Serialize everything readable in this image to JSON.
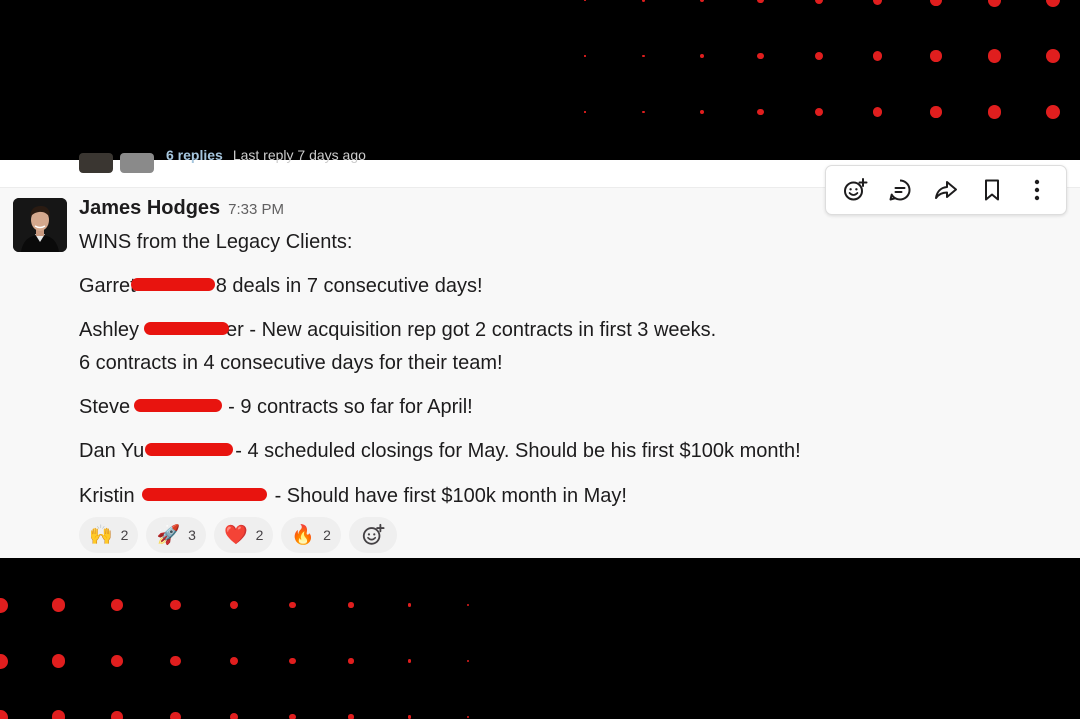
{
  "previous_thread": {
    "replies": "6 replies",
    "last_reply": "Last reply 7 days ago"
  },
  "message": {
    "author": "James Hodges",
    "time": "7:33 PM",
    "intro": "WINS from the Legacy Clients:",
    "wins": [
      {
        "name": "Garret",
        "text": "8 deals in 7 consecutive days!"
      },
      {
        "name": "Ashley",
        "text": "er - New acquisition rep got 2 contracts in first 3 weeks."
      },
      {
        "continuation": "6 contracts in 4 consecutive days for their team!"
      },
      {
        "name": "Steve",
        "text": "- 9 contracts so far for April!"
      },
      {
        "name": "Dan Yu",
        "text": "- 4 scheduled closings for May. Should be his first $100k month!"
      },
      {
        "name": "Kristin",
        "text": "- Should have first $100k month in May!"
      }
    ]
  },
  "reactions": [
    {
      "emoji": "🙌",
      "count": "2"
    },
    {
      "emoji": "🚀",
      "count": "3"
    },
    {
      "emoji": "❤️",
      "count": "2"
    },
    {
      "emoji": "🔥",
      "count": "2"
    }
  ],
  "toolbar_icons": [
    "add-reaction-icon",
    "reply-in-thread-icon",
    "share-icon",
    "bookmark-icon",
    "more-actions-icon"
  ],
  "colors": {
    "accent_red": "#e01e1e",
    "redaction": "#e8140f",
    "text": "#1d1c1d",
    "muted": "#616061"
  }
}
